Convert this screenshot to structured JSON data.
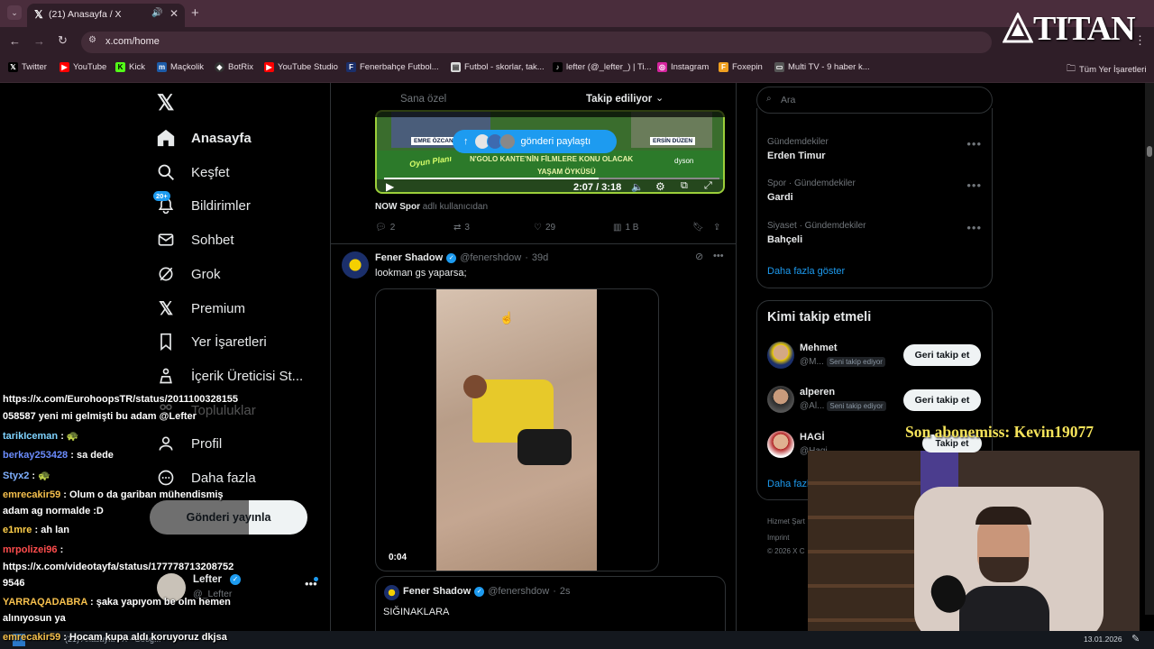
{
  "browser": {
    "tab_title": "(21) Anasayfa / X",
    "url": "x.com/home",
    "bookmarks": [
      {
        "label": "Twitter",
        "icon": "x-logo-icon"
      },
      {
        "label": "YouTube",
        "icon": "youtube-icon"
      },
      {
        "label": "Kick",
        "icon": "kick-icon"
      },
      {
        "label": "Maçkolik",
        "icon": "mackolik-icon"
      },
      {
        "label": "BotRix",
        "icon": "botrix-icon"
      },
      {
        "label": "YouTube Studio",
        "icon": "youtube-studio-icon"
      },
      {
        "label": "Fenerbahçe Futbol...",
        "icon": "fenerbahce-icon"
      },
      {
        "label": "Futbol - skorlar, tak...",
        "icon": "document-icon"
      },
      {
        "label": "lefter (@_lefter_) | Ti...",
        "icon": "tiktok-icon"
      },
      {
        "label": "Instagram",
        "icon": "instagram-icon"
      },
      {
        "label": "Foxepin",
        "icon": "foxepin-icon"
      },
      {
        "label": "Multi TV - 9 haber k...",
        "icon": "tv-icon"
      }
    ],
    "all_bookmarks": "Tüm Yer İşaretleri"
  },
  "nav": {
    "items": [
      {
        "label": "Anasayfa",
        "icon": "home-icon"
      },
      {
        "label": "Keşfet",
        "icon": "search-icon"
      },
      {
        "label": "Bildirimler",
        "icon": "bell-icon",
        "badge": "20+"
      },
      {
        "label": "Sohbet",
        "icon": "mail-icon"
      },
      {
        "label": "Grok",
        "icon": "grok-icon"
      },
      {
        "label": "Premium",
        "icon": "x-logo-icon"
      },
      {
        "label": "Yer İşaretleri",
        "icon": "bookmark-icon"
      },
      {
        "label": "İçerik Üreticisi St...",
        "icon": "creator-studio-icon"
      },
      {
        "label": "Topluluklar",
        "icon": "communities-icon"
      },
      {
        "label": "Profil",
        "icon": "person-icon"
      },
      {
        "label": "Daha fazla",
        "icon": "more-circle-icon"
      }
    ],
    "post_button": "Gönderi yayınla",
    "account": {
      "name": "Lefter",
      "handle": "@_Lefter"
    }
  },
  "feed": {
    "tabs": [
      "Sana özel",
      "Takip ediliyor"
    ],
    "active_tab": 1,
    "new_posts_pill": "gönderi paylaştı",
    "video1": {
      "caption_left": "EMRE ÖZCAN",
      "caption_right": "ERSİN DÜZEN",
      "headline_line1": "N'GOLO KANTE'NİN FİLMLERE KONU OLACAK",
      "headline_line2": "YAŞAM ÖYKÜSÜ",
      "show_logo": "Oyun Planı",
      "sponsor": "dyson",
      "time": "2:07 / 3:18"
    },
    "video1_source": {
      "name": "NOW Spor",
      "suffix": "adlı kullanıcıdan"
    },
    "stats1": {
      "replies": "2",
      "reposts": "3",
      "likes": "29",
      "views": "1 B"
    },
    "post2": {
      "name": "Fener Shadow",
      "handle": "@fenershdow",
      "time": "39d",
      "text": "lookman gs yaparsa;",
      "video_time": "0:04"
    },
    "quote": {
      "name": "Fener Shadow",
      "handle": "@fenershdow",
      "time": "2s",
      "text": "SIĞINAKLARA"
    }
  },
  "sidebar": {
    "search_placeholder": "Ara",
    "trends": [
      {
        "category": "Gündemdekiler",
        "name": "Erden Timur"
      },
      {
        "category": "Spor · Gündemdekiler",
        "name": "Gardi"
      },
      {
        "category": "Siyaset · Gündemdekiler",
        "name": "Bahçeli"
      }
    ],
    "show_more": "Daha fazla göster",
    "who_to_follow_title": "Kimi takip etmeli",
    "suggestions": [
      {
        "name": "Mehmet",
        "handle": "@M...",
        "badge": "Seni takip ediyor",
        "button": "Geri takip et"
      },
      {
        "name": "alperen",
        "handle": "@Al...",
        "badge": "Seni takip ediyor",
        "button": "Geri takip et"
      },
      {
        "name": "HAGİ",
        "handle": "@Hagi...",
        "badge": "",
        "button": "Takip et"
      }
    ],
    "show_more_2": "Daha fazla",
    "footer": [
      "Hizmet Şart",
      "Imprint",
      "© 2026 X C"
    ]
  },
  "overlay": {
    "brand": "TITAN",
    "subscriber": "Son abonemiss: Kevin19077",
    "date": "13.01.2026",
    "taskbar_title": "(21) Anasayfa / X - Goog..."
  },
  "chat": [
    {
      "user": "",
      "text": "https://x.com/EurohoopsTR/status/2011100328155",
      "color": "#ffffff"
    },
    {
      "user": "",
      "text": "058587 yeni mi gelmişti bu adam @Lefter",
      "color": "#ffffff"
    },
    {
      "user": "tarikIceman",
      "text": " : 🐢",
      "color": "#7fd3ff"
    },
    {
      "user": "berkay253428",
      "text": " : sa dede",
      "color": "#6b8cff"
    },
    {
      "user": "Styx2",
      "text": " : 🐢",
      "color": "#7fb0ff"
    },
    {
      "user": "emrecakir59",
      "text": " : Olum o da gariban mühendismiş",
      "color": "#f6c04d"
    },
    {
      "user": "",
      "text": "adam ag normalde :D",
      "color": "#ffffff"
    },
    {
      "user": "e1mre",
      "text": " : ah lan",
      "color": "#ffcf4a"
    },
    {
      "user": "mrpolizei96",
      "text": " :",
      "color": "#ff4d4d"
    },
    {
      "user": "",
      "text": "https://x.com/videotayfa/status/177778713208752",
      "color": "#ffffff"
    },
    {
      "user": "",
      "text": "9546",
      "color": "#ffffff"
    },
    {
      "user": "YARRAQADABRA",
      "text": " : şaka yapıyom be olm hemen",
      "color": "#f6c04d"
    },
    {
      "user": "",
      "text": "alınıyosun ya",
      "color": "#ffffff"
    },
    {
      "user": "emrecakir59",
      "text": " : Hocam kupa aldı koruyoruz dkjsa",
      "color": "#f6c04d"
    }
  ]
}
